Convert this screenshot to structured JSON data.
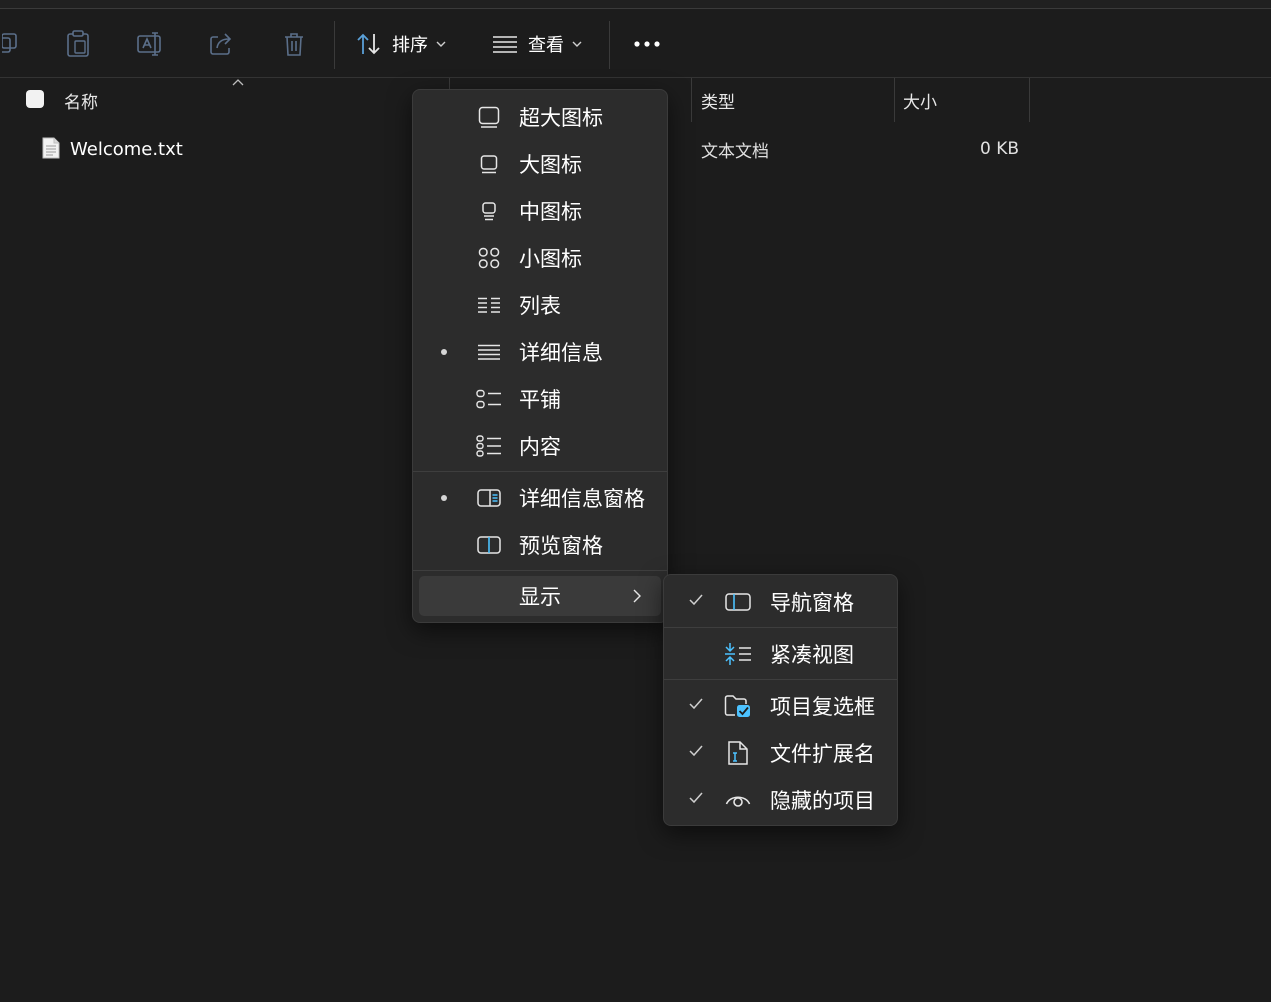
{
  "toolbar": {
    "sort_label": "排序",
    "view_label": "查看"
  },
  "columns": {
    "name": "名称",
    "type": "类型",
    "size": "大小"
  },
  "files": [
    {
      "name": "Welcome.txt",
      "type": "文本文档",
      "size": "0 KB"
    }
  ],
  "view_menu": {
    "items": [
      {
        "label": "超大图标",
        "icon": "extra-large-icons-icon",
        "selected": false
      },
      {
        "label": "大图标",
        "icon": "large-icons-icon",
        "selected": false
      },
      {
        "label": "中图标",
        "icon": "medium-icons-icon",
        "selected": false
      },
      {
        "label": "小图标",
        "icon": "small-icons-icon",
        "selected": false
      },
      {
        "label": "列表",
        "icon": "list-icon",
        "selected": false
      },
      {
        "label": "详细信息",
        "icon": "details-icon",
        "selected": true
      },
      {
        "label": "平铺",
        "icon": "tiles-icon",
        "selected": false
      },
      {
        "label": "内容",
        "icon": "content-icon",
        "selected": false
      }
    ],
    "pane_items": [
      {
        "label": "详细信息窗格",
        "icon": "details-pane-icon",
        "selected": true
      },
      {
        "label": "预览窗格",
        "icon": "preview-pane-icon",
        "selected": false
      }
    ],
    "show_label": "显示"
  },
  "show_submenu": {
    "items": [
      {
        "label": "导航窗格",
        "icon": "navigation-pane-icon",
        "checked": true
      },
      {
        "label": "紧凑视图",
        "icon": "compact-view-icon",
        "checked": false
      },
      {
        "label": "项目复选框",
        "icon": "item-checkboxes-icon",
        "checked": true
      },
      {
        "label": "文件扩展名",
        "icon": "file-extensions-icon",
        "checked": true
      },
      {
        "label": "隐藏的项目",
        "icon": "hidden-items-icon",
        "checked": true
      }
    ]
  },
  "colors": {
    "background": "#1c1c1c",
    "menu_bg": "#2c2c2c",
    "accent": "#4cc2ff"
  }
}
